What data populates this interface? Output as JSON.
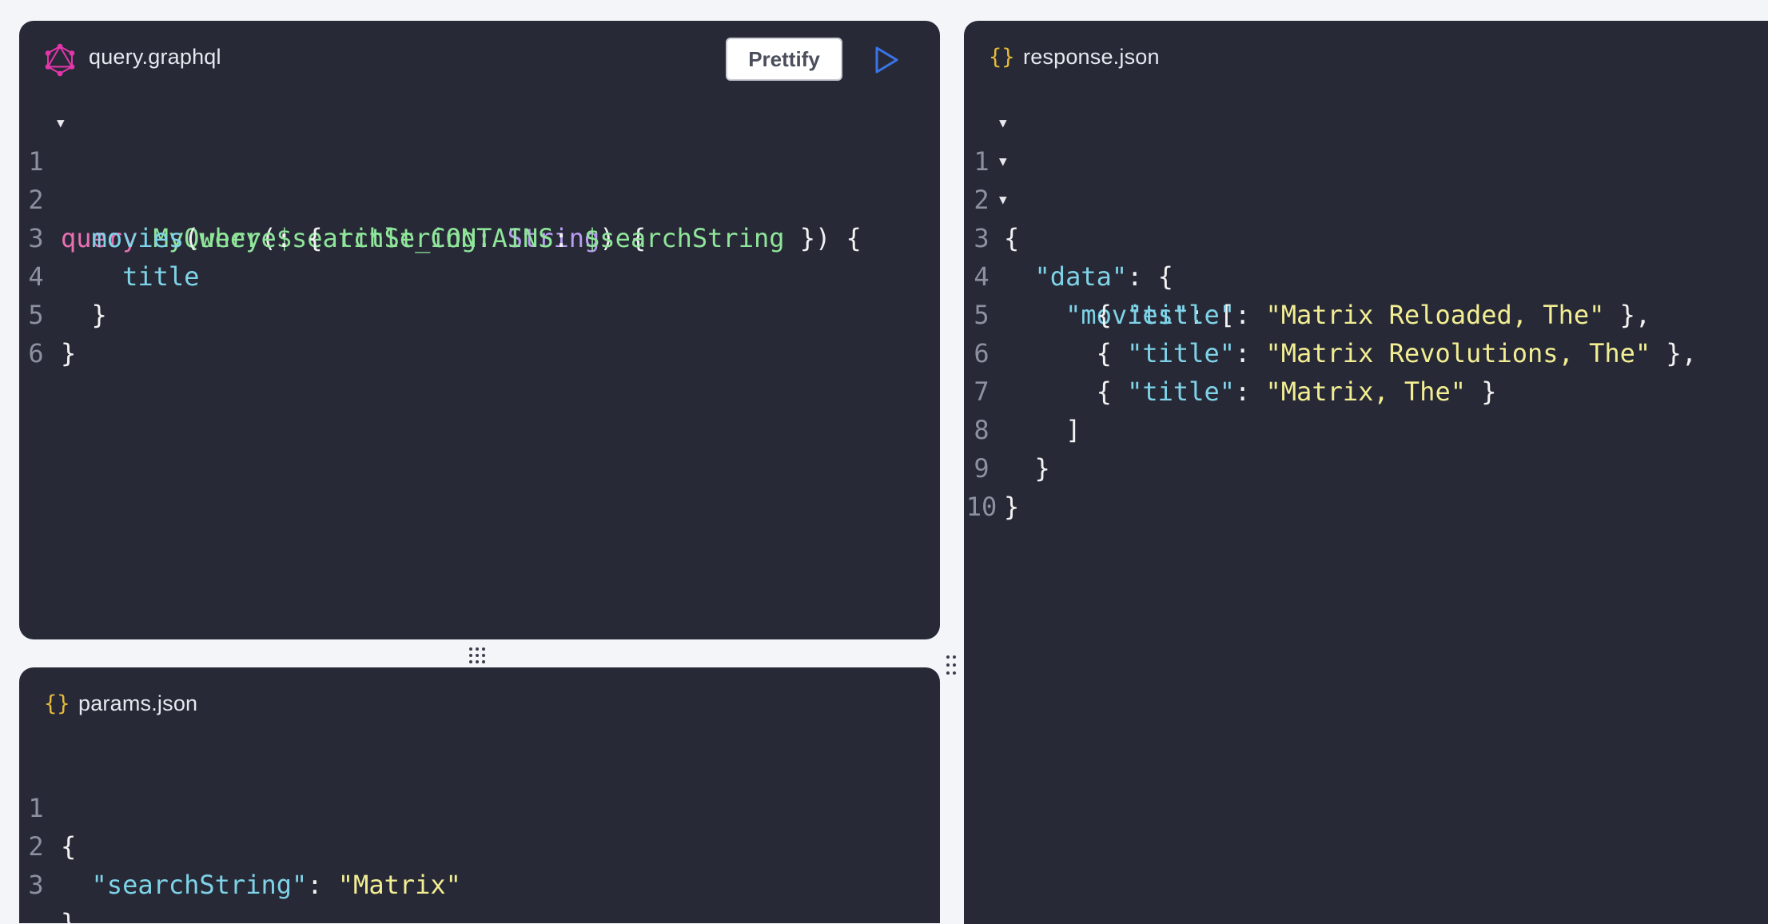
{
  "query_editor": {
    "filename": "query.graphql",
    "prettify_label": "Prettify",
    "line_numbers": [
      "1",
      "2",
      "3",
      "4",
      "5",
      "6"
    ]
  },
  "params_editor": {
    "filename": "params.json",
    "braces_glyph": "{}",
    "line_numbers": [
      "1",
      "2",
      "3"
    ]
  },
  "response_viewer": {
    "filename": "response.json",
    "braces_glyph": "{}",
    "line_numbers": [
      "1",
      "2",
      "3",
      "4",
      "5",
      "6",
      "7",
      "8",
      "9",
      "10"
    ]
  },
  "colors": {
    "panel_bg": "#272a36",
    "page_bg": "#f3f5f9",
    "graphql_logo": "#e535ab",
    "run_icon": "#3b74e8",
    "json_icon": "#e5b93a"
  },
  "code": {
    "query": {
      "keyword": "query",
      "op_name": "MyQuery",
      "var": "$searchString",
      "type": "String",
      "root_field": "movies",
      "arg": "where",
      "filter_field": "title_CONTAINS",
      "filter_var": "$searchString",
      "selected_field": "title"
    },
    "params": {
      "key": "\"searchString\"",
      "value": "\"Matrix\""
    },
    "response": {
      "data_key": "\"data\"",
      "movies_key": "\"movies\"",
      "title_key": "\"title\"",
      "titles": [
        "\"Matrix Reloaded, The\"",
        "\"Matrix Revolutions, The\"",
        "\"Matrix, The\""
      ]
    }
  }
}
